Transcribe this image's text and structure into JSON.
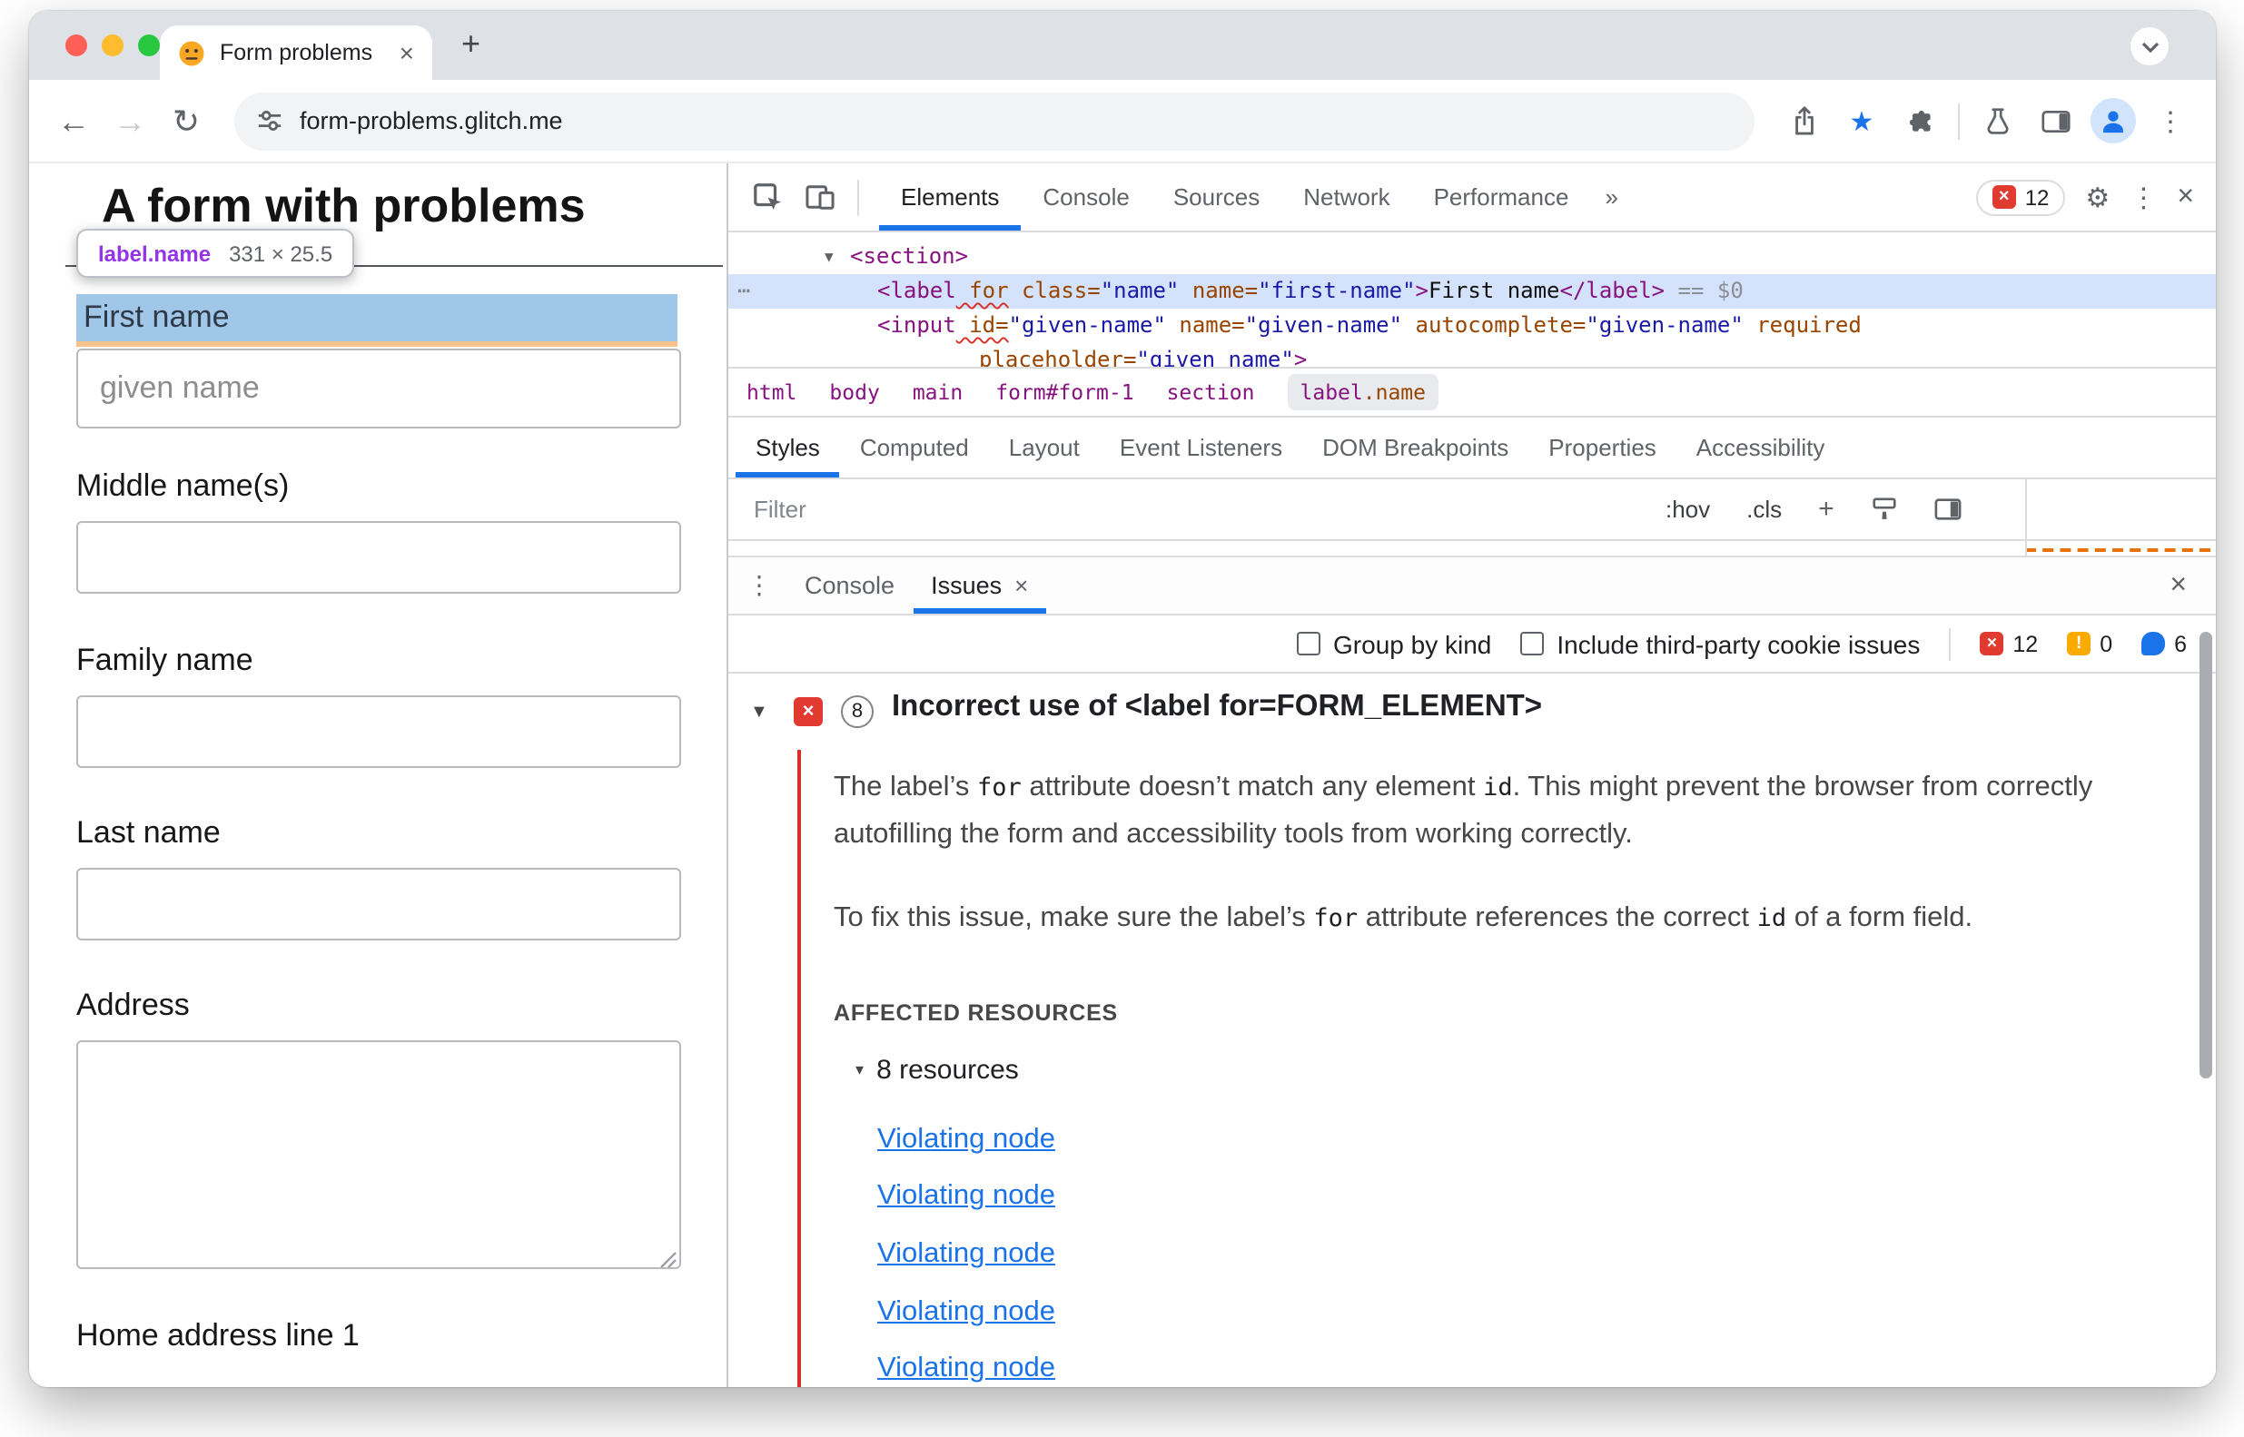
{
  "icons": {
    "close": "×",
    "plus": "+",
    "more_tabs": "»",
    "kebab": "⋮",
    "gear": "⚙",
    "back": "←",
    "forward": "→",
    "reload": "↻",
    "star": "★",
    "expand": "▼",
    "triangle_small": "▾",
    "dots": "⋯",
    "error_x": "×",
    "warn_mark": "!"
  },
  "browser": {
    "tab_title": "Form problems",
    "url": "form-problems.glitch.me"
  },
  "page": {
    "heading": "A form with problems",
    "tooltip": {
      "selector": "label.name",
      "size": "331 × 25.5"
    },
    "first_name": {
      "label": "First name",
      "placeholder": "given name"
    },
    "fields": [
      {
        "label": "Middle name(s)"
      },
      {
        "label": "Family name"
      },
      {
        "label": "Last name"
      },
      {
        "label": "Address"
      },
      {
        "label": "Home address line 1"
      }
    ]
  },
  "devtools": {
    "tabs": [
      "Elements",
      "Console",
      "Sources",
      "Network",
      "Performance"
    ],
    "error_count": "12",
    "code": {
      "line1": [
        {
          "c": "tag",
          "t": "<section>"
        }
      ],
      "line2": [
        {
          "c": "tag",
          "t": "<label"
        },
        {
          "c": "attrw",
          "t": " for"
        },
        {
          "c": "attr",
          "t": " class="
        },
        {
          "c": "val",
          "t": "\"name\""
        },
        {
          "c": "attr",
          "t": " name="
        },
        {
          "c": "val",
          "t": "\"first-name\""
        },
        {
          "c": "tag",
          "t": ">"
        },
        {
          "c": "txt",
          "t": "First name"
        },
        {
          "c": "tag",
          "t": "</label>"
        },
        {
          "c": "meta",
          "t": " == $0"
        }
      ],
      "line3": [
        {
          "c": "tag",
          "t": "<input"
        },
        {
          "c": "attrw",
          "t": " id="
        },
        {
          "c": "val",
          "t": "\"given-name\""
        },
        {
          "c": "attr",
          "t": " name="
        },
        {
          "c": "val",
          "t": "\"given-name\""
        },
        {
          "c": "attr",
          "t": " autocomplete="
        },
        {
          "c": "val",
          "t": "\"given-name\""
        },
        {
          "c": "attr",
          "t": " required"
        }
      ],
      "line4": [
        {
          "c": "attr",
          "t": "placeholder="
        },
        {
          "c": "val",
          "t": "\"given name\""
        },
        {
          "c": "tag",
          "t": ">"
        }
      ]
    },
    "breadcrumbs": [
      "html",
      "body",
      "main",
      "form#form-1",
      "section"
    ],
    "breadcrumb_selected": {
      "tag": "label",
      "class": ".name"
    },
    "sidebar_tabs": [
      "Styles",
      "Computed",
      "Layout",
      "Event Listeners",
      "DOM Breakpoints",
      "Properties",
      "Accessibility"
    ],
    "filter": {
      "label": "Filter",
      "hov": ":hov",
      "cls": ".cls"
    },
    "drawer": {
      "console": "Console",
      "issues": "Issues"
    },
    "issues": {
      "group_by_kind": "Group by kind",
      "include_third_party": "Include third-party cookie issues",
      "error_count": "12",
      "warning_count": "0",
      "message_count": "6",
      "count": "8",
      "title": "Incorrect use of <label for=FORM_ELEMENT>",
      "para1": [
        {
          "c": "t",
          "t": "The label’s "
        },
        {
          "c": "code",
          "t": "for"
        },
        {
          "c": "t",
          "t": " attribute doesn’t match any element "
        },
        {
          "c": "code",
          "t": "id"
        },
        {
          "c": "t",
          "t": ". This might prevent the browser from correctly autofilling the form and accessibility tools from working correctly."
        }
      ],
      "para2": [
        {
          "c": "t",
          "t": "To fix this issue, make sure the label’s "
        },
        {
          "c": "code",
          "t": "for"
        },
        {
          "c": "t",
          "t": " attribute references the correct "
        },
        {
          "c": "code",
          "t": "id"
        },
        {
          "c": "t",
          "t": " of a form field."
        }
      ],
      "affected": "AFFECTED RESOURCES",
      "resources": "8 resources",
      "links": [
        "Violating node",
        "Violating node",
        "Violating node",
        "Violating node",
        "Violating node"
      ]
    }
  }
}
